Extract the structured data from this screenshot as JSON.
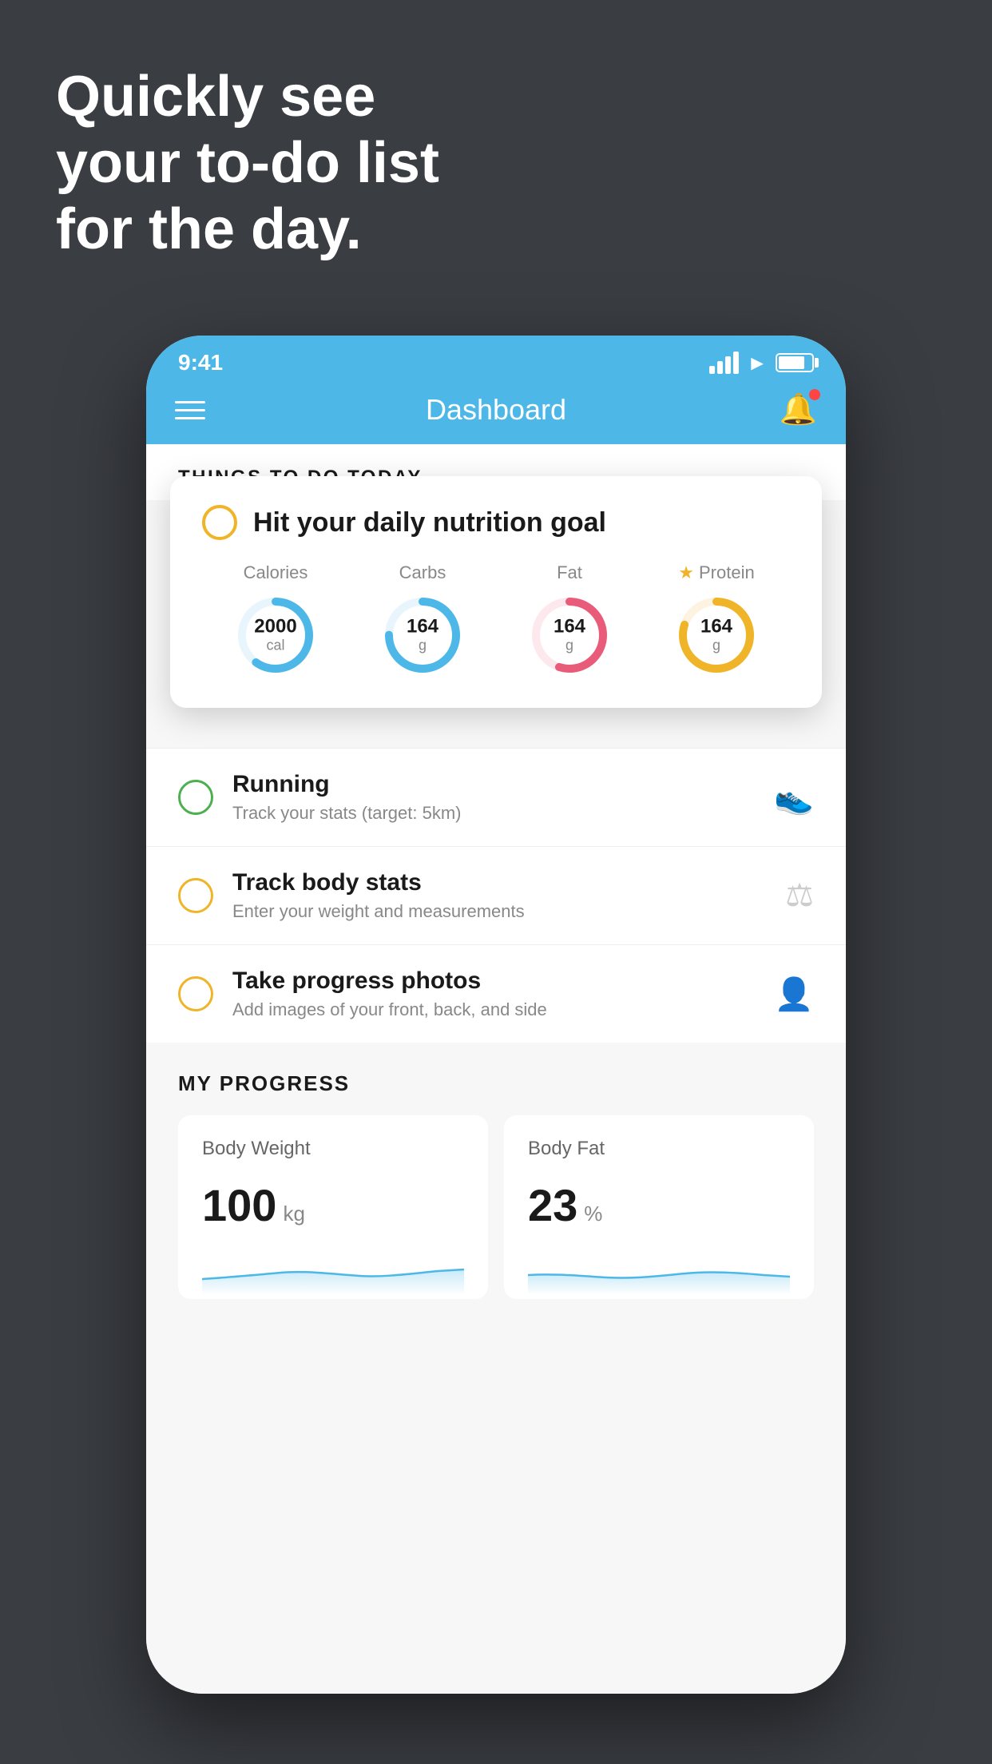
{
  "hero": {
    "line1": "Quickly see",
    "line2": "your to-do list",
    "line3": "for the day."
  },
  "statusBar": {
    "time": "9:41"
  },
  "navBar": {
    "title": "Dashboard"
  },
  "thingsToday": {
    "header": "THINGS TO DO TODAY"
  },
  "nutritionCard": {
    "title": "Hit your daily nutrition goal",
    "items": [
      {
        "label": "Calories",
        "value": "2000",
        "unit": "cal",
        "color": "#4db8e8",
        "percent": 60
      },
      {
        "label": "Carbs",
        "value": "164",
        "unit": "g",
        "color": "#4db8e8",
        "percent": 75
      },
      {
        "label": "Fat",
        "value": "164",
        "unit": "g",
        "color": "#e85c7a",
        "percent": 55
      },
      {
        "label": "Protein",
        "value": "164",
        "unit": "g",
        "color": "#f0b429",
        "percent": 80,
        "starred": true
      }
    ]
  },
  "todoItems": [
    {
      "title": "Running",
      "subtitle": "Track your stats (target: 5km)",
      "circleColor": "green",
      "icon": "shoe"
    },
    {
      "title": "Track body stats",
      "subtitle": "Enter your weight and measurements",
      "circleColor": "yellow",
      "icon": "scale"
    },
    {
      "title": "Take progress photos",
      "subtitle": "Add images of your front, back, and side",
      "circleColor": "yellow",
      "icon": "person"
    }
  ],
  "progressSection": {
    "header": "MY PROGRESS",
    "cards": [
      {
        "title": "Body Weight",
        "value": "100",
        "unit": "kg"
      },
      {
        "title": "Body Fat",
        "value": "23",
        "unit": "%"
      }
    ]
  }
}
